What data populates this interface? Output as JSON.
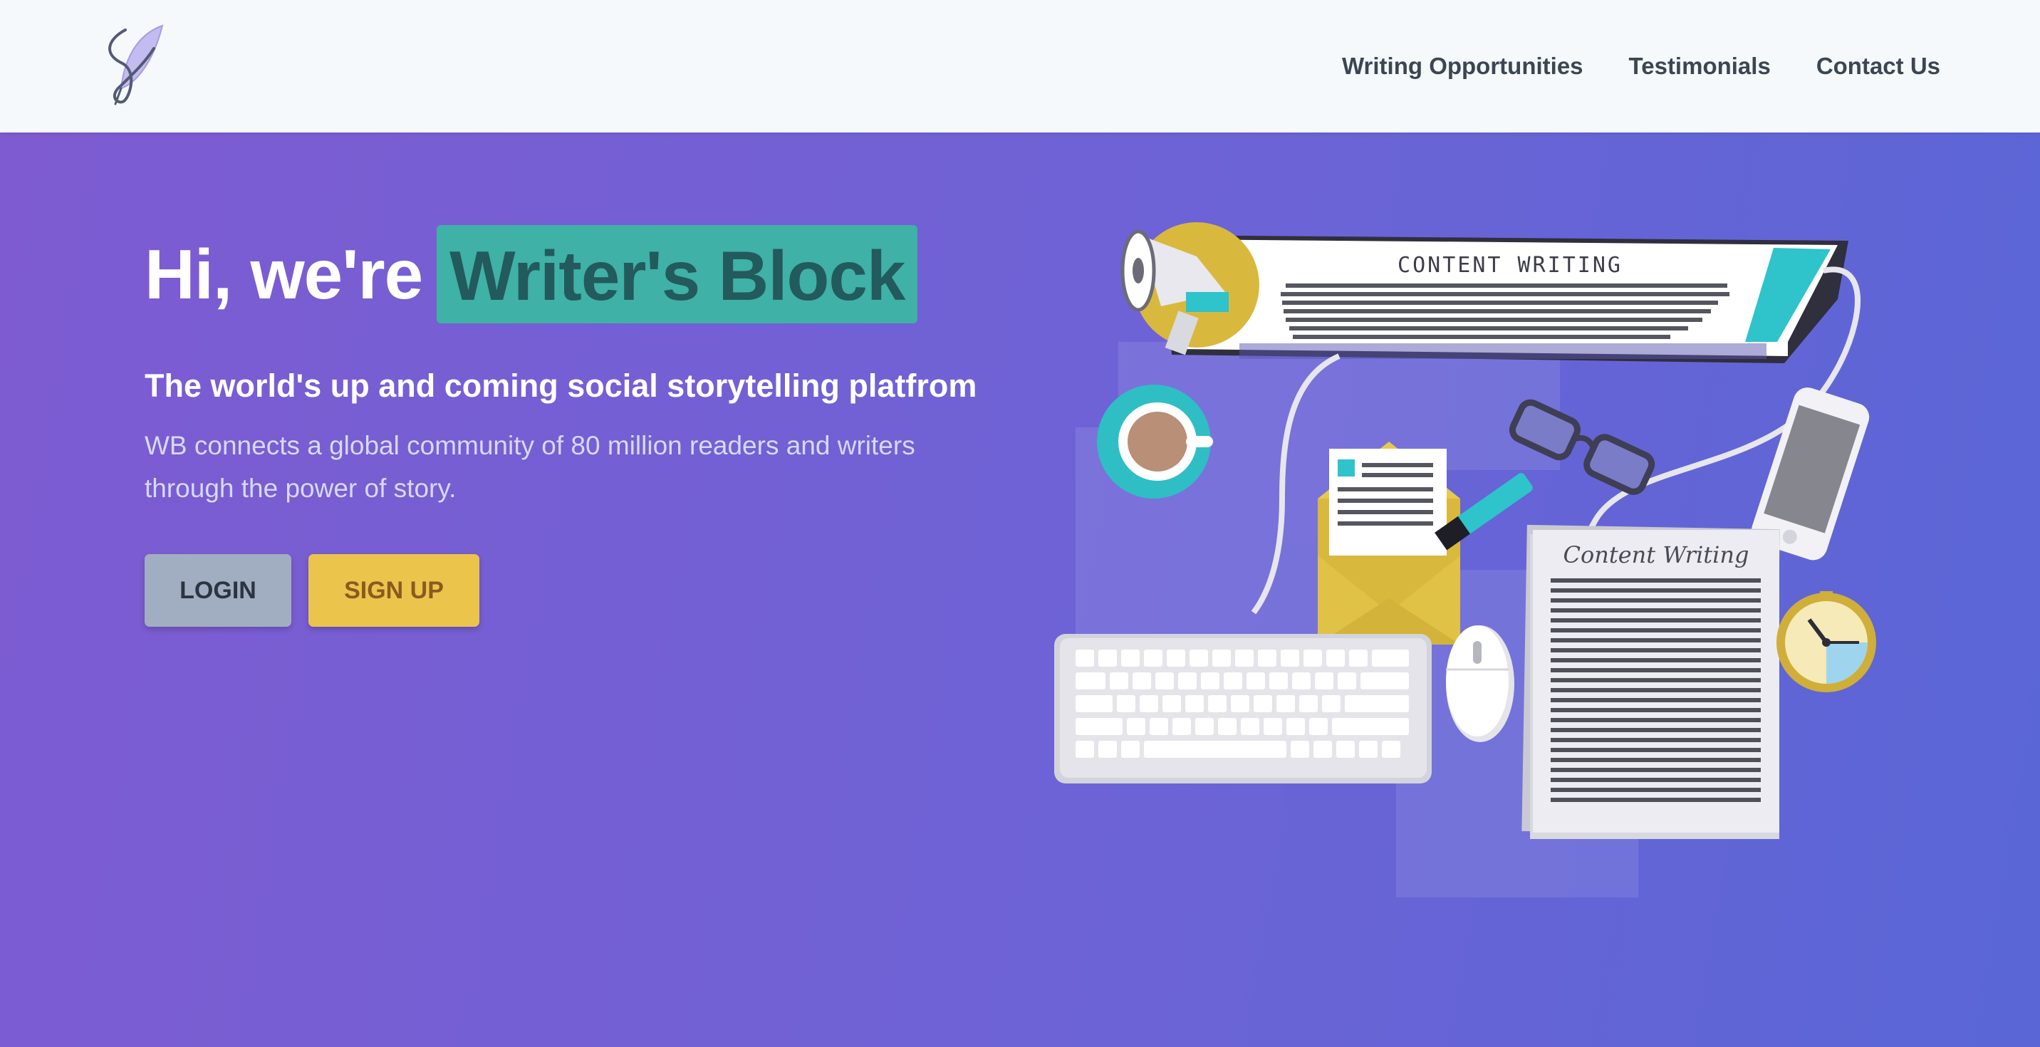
{
  "nav": {
    "links": [
      "Writing Opportunities",
      "Testimonials",
      "Contact Us"
    ]
  },
  "hero": {
    "title_prefix": "Hi, we're",
    "title_highlight": "Writer's Block",
    "tagline": "The world's up and coming social storytelling platfrom",
    "description": "WB connects a global community of 80 million readers and writers through the power of story.",
    "login_label": "LOGIN",
    "signup_label": "SIGN UP"
  },
  "illustration": {
    "screen_text": "CONTENT WRITING",
    "paper_text": "Content Writing"
  },
  "colors": {
    "nav_bg": "#f5f9fc",
    "hero_gradient_start": "#7e5bd1",
    "hero_gradient_end": "#5a66d6",
    "highlight_bg": "#3fb1a6",
    "login_bg": "#a1aec1",
    "signup_bg": "#ebc44c"
  },
  "icons": [
    "feather-quill-logo-icon"
  ]
}
